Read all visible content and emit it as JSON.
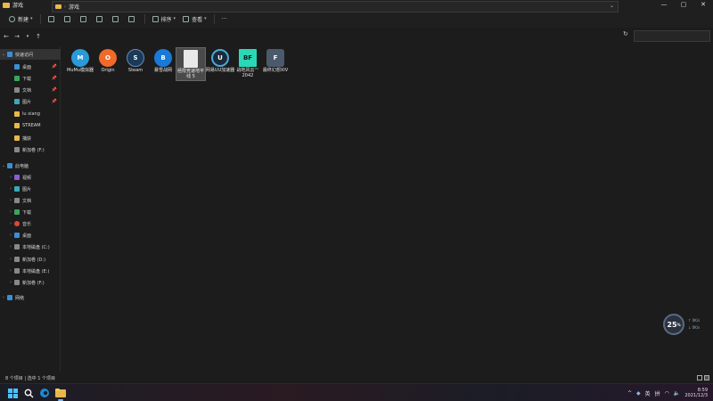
{
  "window": {
    "title": "游戏",
    "controls": [
      "—",
      "▢",
      "✕"
    ]
  },
  "toolbar": {
    "new_label": "新建",
    "sort_label": "排序",
    "view_label": "查看",
    "more_label": "···"
  },
  "address": {
    "path": "游戏"
  },
  "sidebar": {
    "quick_access": {
      "label": "快速访问",
      "items": [
        {
          "label": "桌面",
          "icon": "desktop-icon",
          "pinned": true
        },
        {
          "label": "下载",
          "icon": "download-icon",
          "pinned": true
        },
        {
          "label": "文档",
          "icon": "document-icon",
          "pinned": true
        },
        {
          "label": "图片",
          "icon": "picture-icon",
          "pinned": true
        },
        {
          "label": "lu xiang",
          "icon": "folder-icon",
          "pinned": false
        },
        {
          "label": "STREAM",
          "icon": "folder-icon",
          "pinned": false
        },
        {
          "label": "捕获",
          "icon": "folder-icon",
          "pinned": false
        },
        {
          "label": "新加卷 (F:)",
          "icon": "drive-icon",
          "pinned": false
        }
      ]
    },
    "this_pc": {
      "label": "此电脑",
      "items": [
        {
          "label": "视频",
          "icon": "video-icon"
        },
        {
          "label": "图片",
          "icon": "picture-icon"
        },
        {
          "label": "文档",
          "icon": "document-icon"
        },
        {
          "label": "下载",
          "icon": "download-icon"
        },
        {
          "label": "音乐",
          "icon": "music-icon"
        },
        {
          "label": "桌面",
          "icon": "desktop-icon"
        },
        {
          "label": "本地磁盘 (C:)",
          "icon": "drive-icon"
        },
        {
          "label": "新加卷 (D:)",
          "icon": "drive-icon"
        },
        {
          "label": "本地磁盘 (E:)",
          "icon": "drive-icon"
        },
        {
          "label": "新加卷 (F:)",
          "icon": "drive-icon"
        }
      ]
    },
    "network": {
      "label": "网络",
      "icon": "network-icon"
    }
  },
  "files": [
    {
      "label": "MuMu模拟器",
      "icon": "mumu-icon",
      "color": "#2a9ad8",
      "glyph": "M"
    },
    {
      "label": "Origin",
      "icon": "origin-icon",
      "color": "#f06a2a",
      "glyph": "O"
    },
    {
      "label": "Steam",
      "icon": "steam-icon",
      "color": "#1b3a5a",
      "glyph": "S"
    },
    {
      "label": "暴雪战网",
      "icon": "battlenet-icon",
      "color": "#1a7ad8",
      "glyph": "B"
    },
    {
      "label": "極限竞速地平线 5",
      "icon": "blank-file-icon",
      "color": "#e8e8e8",
      "glyph": ""
    },
    {
      "label": "网易UU加速器",
      "icon": "uu-icon",
      "color": "#1a2a3a",
      "glyph": "U"
    },
    {
      "label": "战地风云™ 2042",
      "icon": "bf2042-icon",
      "color": "#2ad8b8",
      "glyph": "BF"
    },
    {
      "label": "最终幻想XIV",
      "icon": "ffxiv-icon",
      "color": "#4a5a6a",
      "glyph": "F"
    }
  ],
  "status": {
    "text": "8 个项目  |  选中 1 个项目"
  },
  "widget": {
    "percent": "25",
    "unit": "%",
    "up": "0K/s",
    "down": "0K/s"
  },
  "taskbar": {
    "ime": "英",
    "ime2": "拼",
    "time": "8:59",
    "date": "2021/12/3"
  }
}
